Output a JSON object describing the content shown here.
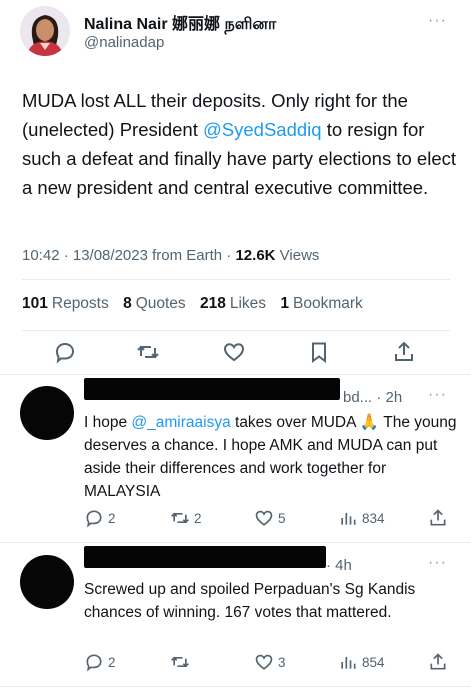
{
  "tweet": {
    "author_name": "Nalina Nair 娜丽娜 நளினா",
    "author_handle": "@nalinadap",
    "text_before": "MUDA lost ALL their deposits. Only right for the (unelected) President ",
    "mention": "@SyedSaddiq",
    "text_after": " to resign for such a defeat and finally have party elections to elect a new president and central executive committee.",
    "timestamp": "10:42 · 13/08/2023 from Earth · ",
    "views_count": "12.6K",
    "views_label": " Views",
    "reposts_count": "101",
    "reposts_label": "Reposts",
    "quotes_count": "8",
    "quotes_label": "Quotes",
    "likes_count": "218",
    "likes_label": "Likes",
    "bookmarks_count": "1",
    "bookmarks_label": "Bookmark"
  },
  "replies": [
    {
      "time": "bd... · 2h",
      "text_before": "I hope ",
      "mention": "@_amiraaisya",
      "text_after": " takes over MUDA 🙏 The young deserves a chance. I hope AMK and MUDA can put aside their differences and work together for MALAYSIA",
      "reply_count": "2",
      "repost_count": "2",
      "like_count": "5",
      "view_count": "834"
    },
    {
      "time": "· 4h",
      "text": "Screwed up and spoiled Perpaduan's Sg Kandis chances of winning. 167 votes that mattered.",
      "reply_count": "2",
      "repost_count": "",
      "like_count": "3",
      "view_count": "854"
    }
  ],
  "more_label": "···"
}
